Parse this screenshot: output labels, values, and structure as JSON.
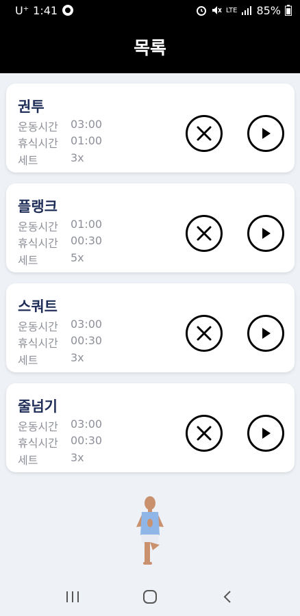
{
  "status_bar": {
    "carrier": "U⁺",
    "time": "1:41",
    "network": "LTE",
    "battery": "85%"
  },
  "header": {
    "title": "목록"
  },
  "stat_labels": {
    "exercise": "운동시간",
    "rest": "휴식시간",
    "sets": "세트"
  },
  "workouts": [
    {
      "name": "권투",
      "exercise_time": "03:00",
      "rest_time": "01:00",
      "sets": "3x"
    },
    {
      "name": "플랭크",
      "exercise_time": "01:00",
      "rest_time": "00:30",
      "sets": "5x"
    },
    {
      "name": "스쿼트",
      "exercise_time": "03:00",
      "rest_time": "00:30",
      "sets": "3x"
    },
    {
      "name": "줄넘기",
      "exercise_time": "03:00",
      "rest_time": "00:30",
      "sets": "3x"
    }
  ],
  "icons": {
    "delete": "close-circle-icon",
    "play": "play-circle-icon",
    "nav_recent": "recent-apps-icon",
    "nav_home": "home-icon",
    "nav_back": "back-icon"
  }
}
